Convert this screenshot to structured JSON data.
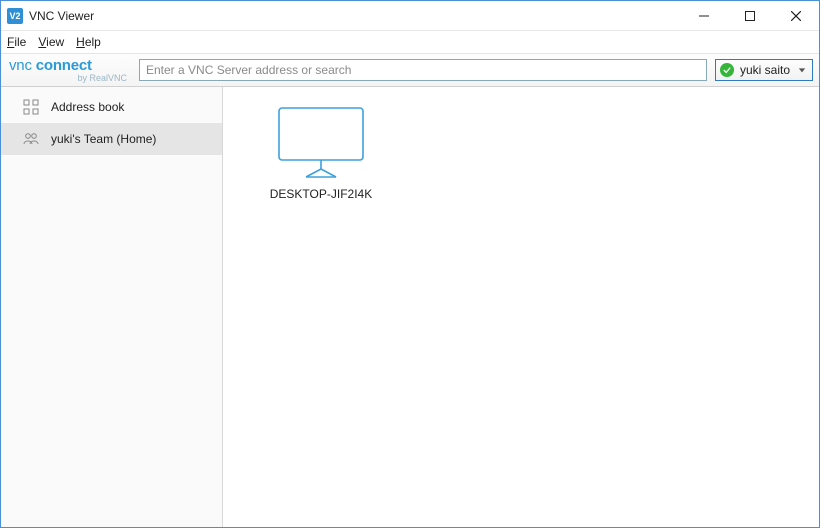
{
  "titlebar": {
    "app_icon_text": "V2",
    "title": "VNC Viewer"
  },
  "menubar": {
    "file_pre": "",
    "file_ul": "F",
    "file_post": "ile",
    "view_pre": "",
    "view_ul": "V",
    "view_post": "iew",
    "help_pre": "",
    "help_ul": "H",
    "help_post": "elp"
  },
  "toolbar": {
    "brand_vnc": "vnc",
    "brand_connect": "connect",
    "brand_sub": "by RealVNC",
    "search_placeholder": "Enter a VNC Server address or search",
    "search_value": "",
    "user_label": "yuki saito"
  },
  "sidebar": {
    "items": [
      {
        "label": "Address book",
        "selected": false,
        "icon": "grid"
      },
      {
        "label": "yuki's Team (Home)",
        "selected": true,
        "icon": "people"
      }
    ]
  },
  "content": {
    "computers": [
      {
        "name": "DESKTOP-JIF2I4K"
      }
    ]
  },
  "colors": {
    "window_border": "#4a90d6",
    "accent_blue": "#2f8fd6",
    "status_green": "#35b53a"
  }
}
